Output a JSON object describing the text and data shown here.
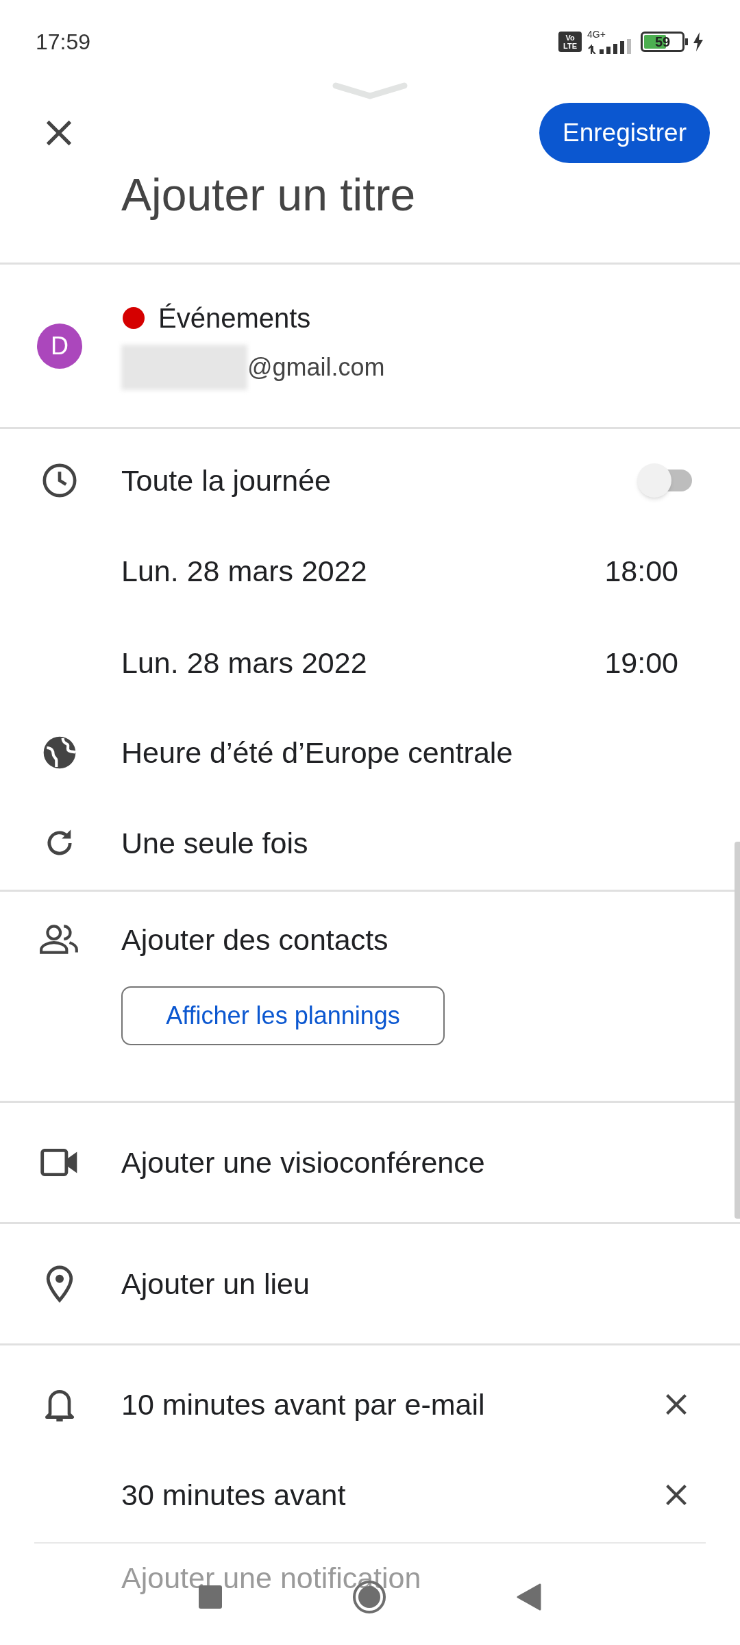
{
  "status_bar": {
    "time": "17:59",
    "network": "4G+",
    "volte": "Vo LTE",
    "battery": "59",
    "charging": true
  },
  "header": {
    "save_label": "Enregistrer",
    "title_placeholder": "Ajouter un titre"
  },
  "calendar": {
    "avatar_letter": "D",
    "name": "Événements",
    "color": "#d50000",
    "email_visible": "@gmail.com"
  },
  "time": {
    "all_day_label": "Toute la journée",
    "all_day": false,
    "start": {
      "date": "Lun. 28 mars 2022",
      "time": "18:00"
    },
    "end": {
      "date": "Lun. 28 mars 2022",
      "time": "19:00"
    },
    "timezone": "Heure d’été d’Europe centrale",
    "recurrence": "Une seule fois"
  },
  "guests": {
    "label": "Ajouter des contacts",
    "schedules_button": "Afficher les plannings"
  },
  "conference": {
    "label": "Ajouter une visioconférence"
  },
  "location": {
    "label": "Ajouter un lieu"
  },
  "notifications": [
    {
      "label": "10 minutes avant par e-mail"
    },
    {
      "label": "30 minutes avant"
    }
  ],
  "add_notification": "Ajouter une notification"
}
